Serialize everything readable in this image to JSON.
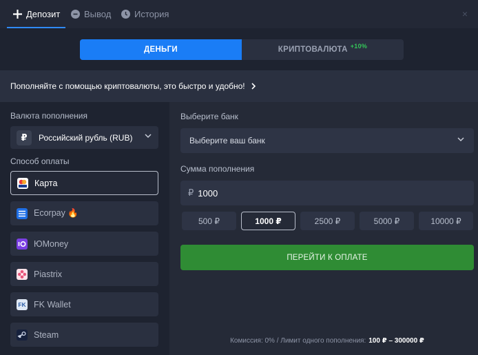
{
  "tabs": [
    {
      "label": "Депозит",
      "icon": "plus-icon",
      "active": true
    },
    {
      "label": "Вывод",
      "icon": "minus-circle-icon",
      "active": false
    },
    {
      "label": "История",
      "icon": "clock-icon",
      "active": false
    }
  ],
  "close_symbol": "×",
  "segmented": {
    "money": "ДЕНЬГИ",
    "crypto": "КРИПТОВАЛЮТА",
    "crypto_bonus": "+10%"
  },
  "promo": {
    "text": "Пополняйте с помощью криптовалюты, это быстро и удобно!"
  },
  "left": {
    "currency_label": "Валюта пополнения",
    "currency_symbol": "₽",
    "currency_value": "Российский рубль (RUB)",
    "method_label": "Способ оплаты",
    "methods": [
      {
        "label": "Карта",
        "icon": "visa-card-icon",
        "selected": true
      },
      {
        "label": "Ecorpay 🔥",
        "icon": "ecorpay-icon",
        "selected": false
      },
      {
        "label": "ЮMoney",
        "icon": "yoomoney-icon",
        "selected": false
      },
      {
        "label": "Piastrix",
        "icon": "piastrix-icon",
        "selected": false
      },
      {
        "label": "FK Wallet",
        "icon": "fk-wallet-icon",
        "selected": false
      },
      {
        "label": "Steam",
        "icon": "steam-icon",
        "selected": false
      }
    ]
  },
  "right": {
    "bank_label": "Выберите банк",
    "bank_placeholder": "Выберите ваш банк",
    "amount_label": "Сумма пополнения",
    "amount_currency": "₽",
    "amount_value": "1000",
    "presets": [
      "500 ₽",
      "1000 ₽",
      "2500 ₽",
      "5000 ₽",
      "10000 ₽"
    ],
    "selected_preset": "1000 ₽",
    "pay_button": "ПЕРЕЙТИ К ОПЛАТЕ",
    "footer_text": "Комиссия: 0% / Лимит одного пополнения:",
    "footer_limit": "100 ₽ – 300000 ₽"
  },
  "colors": {
    "accent": "#1a7df6",
    "pay": "#2f8c34",
    "bonus": "#34c759"
  }
}
